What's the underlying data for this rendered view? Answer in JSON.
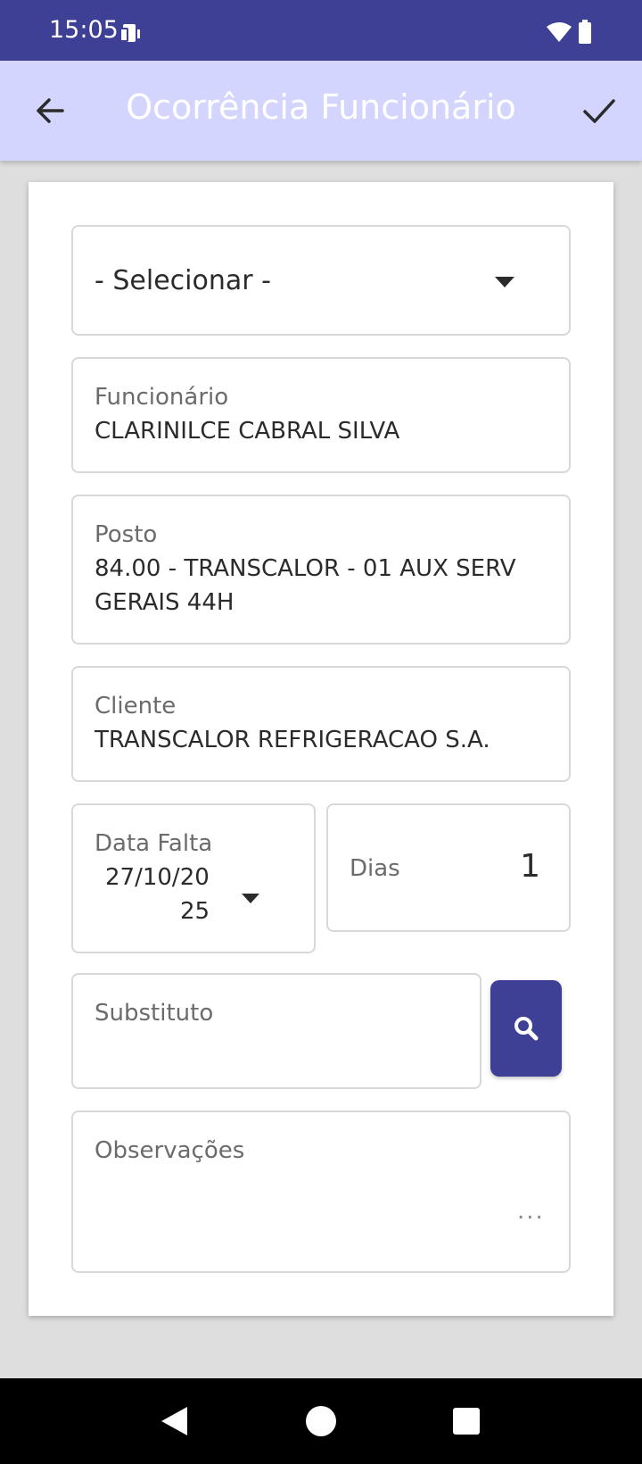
{
  "status_bar": {
    "time": "15:05"
  },
  "app_bar": {
    "title": "Ocorrência Funcionário"
  },
  "form": {
    "tipo_select": {
      "value": "- Selecionar -"
    },
    "funcionario": {
      "label": "Funcionário",
      "value": "CLARINILCE CABRAL SILVA"
    },
    "posto": {
      "label": "Posto",
      "value_line1": "84.00 - TRANSCALOR - 01 AUX SERV",
      "value_line2": "GERAIS 44H"
    },
    "cliente": {
      "label": "Cliente",
      "value": "TRANSCALOR REFRIGERACAO S.A."
    },
    "data_falta": {
      "label": "Data Falta",
      "value_line1": "27/10/20",
      "value_line2": "25"
    },
    "dias": {
      "label": "Dias",
      "value": "1"
    },
    "substituto": {
      "label": "Substituto",
      "value": ""
    },
    "observacoes": {
      "label": "Observações",
      "value": "",
      "more": "..."
    }
  },
  "colors": {
    "status_bar": "#3e4095",
    "app_bar": "#d3d5ff",
    "search_button": "#3e4095"
  }
}
